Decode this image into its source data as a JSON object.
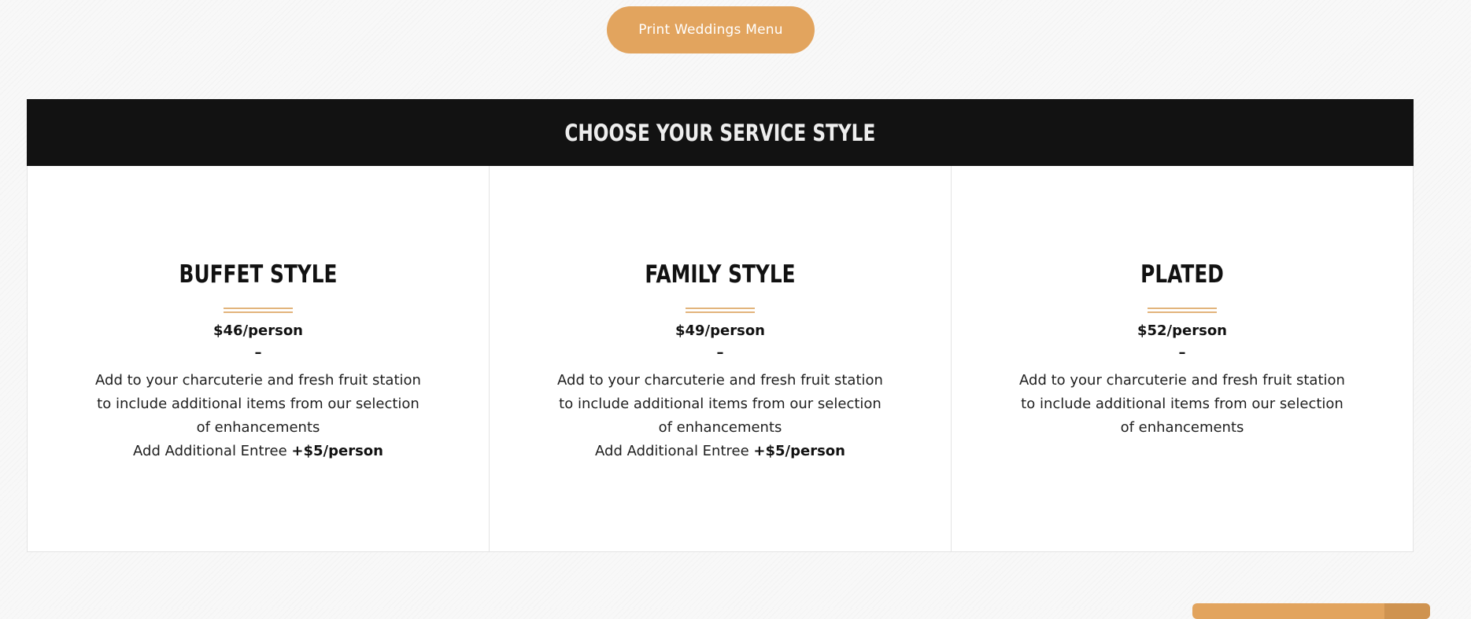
{
  "print_button": {
    "label": "Print Weddings Menu"
  },
  "section": {
    "title": "CHOOSE YOUR SERVICE STYLE",
    "cards": [
      {
        "title": "BUFFET STYLE",
        "price": "$46/person",
        "dash": "–",
        "description": "Add to your charcuterie and fresh fruit station to include additional items from our selection of enhancements",
        "extra_prefix": "Add Additional Entree ",
        "extra_price": "+$5/person"
      },
      {
        "title": "FAMILY STYLE",
        "price": "$49/person",
        "dash": "–",
        "description": "Add to your charcuterie and fresh fruit station to include additional items from our selection of enhancements",
        "extra_prefix": "Add Additional Entree ",
        "extra_price": "+$5/person"
      },
      {
        "title": "PLATED",
        "price": "$52/person",
        "dash": "–",
        "description": "Add to your charcuterie and fresh fruit station to include additional items from our selection of enhancements"
      }
    ]
  },
  "colors": {
    "accent": "#e2a45e",
    "header_bg": "#121212",
    "divider": "#e2b47c"
  }
}
